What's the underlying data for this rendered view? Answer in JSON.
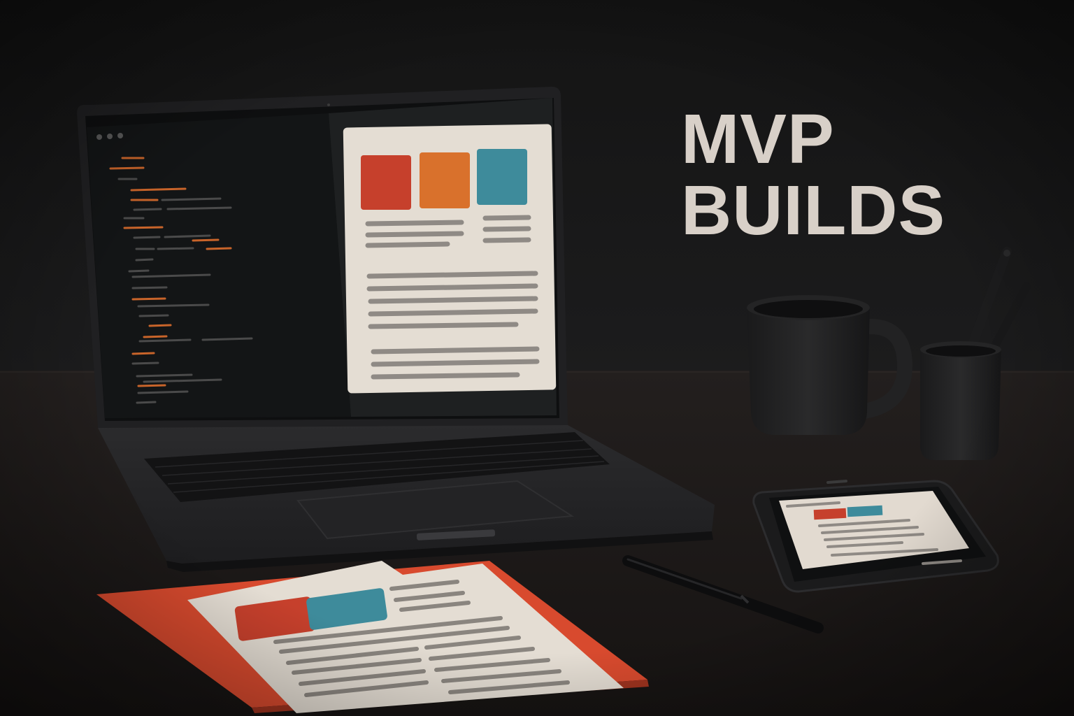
{
  "headline": {
    "line1": "MVP",
    "line2": "BUILDS"
  },
  "colors": {
    "background": "#171718",
    "desk": "#231f1e",
    "headline_text": "#d8d0c8",
    "accent_red": "#c6402c",
    "accent_orange": "#d9712c",
    "accent_teal": "#3e8b9b",
    "paper": "#e4ddd3",
    "folder": "#d84a2e",
    "text_line": "#8f8a85",
    "code_orange": "#c8642a",
    "code_gray": "#4a4a4a"
  },
  "icons": [
    "laptop-icon",
    "smartphone-icon",
    "coffee-mug-icon",
    "pencil-cup-icon",
    "pen-icon",
    "document-icon",
    "folder-icon"
  ]
}
